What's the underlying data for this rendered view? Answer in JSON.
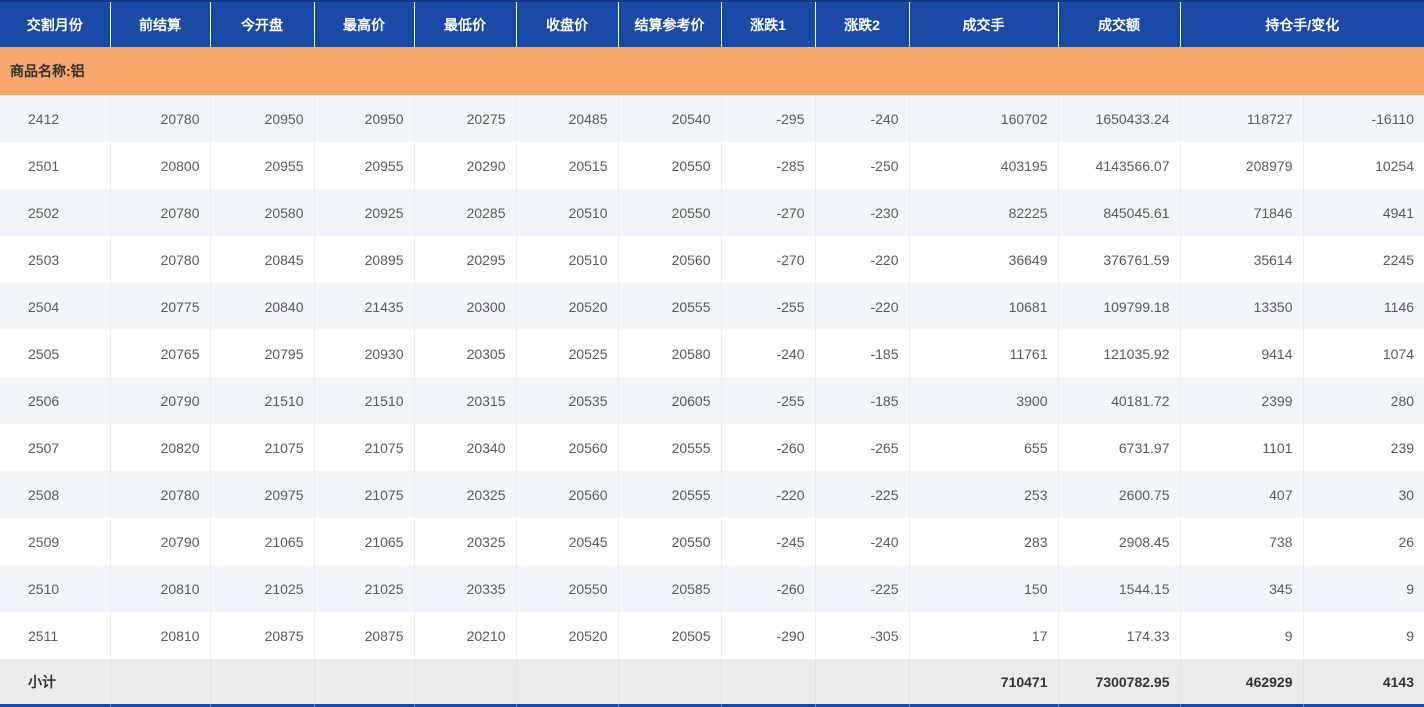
{
  "table": {
    "headers": [
      "交割月份",
      "前结算",
      "今开盘",
      "最高价",
      "最低价",
      "收盘价",
      "结算参考价",
      "涨跌1",
      "涨跌2",
      "成交手",
      "成交额",
      "持仓手/变化"
    ],
    "section_label": "商品名称:铝",
    "field_order": [
      "month",
      "prev_settlement",
      "open",
      "high",
      "low",
      "close",
      "settlement_ref",
      "change1",
      "change2",
      "volume",
      "turnover",
      "open_interest",
      "oi_change"
    ],
    "rows": [
      {
        "month": "2412",
        "prev_settlement": "20780",
        "open": "20950",
        "high": "20950",
        "low": "20275",
        "close": "20485",
        "settlement_ref": "20540",
        "change1": "-295",
        "change2": "-240",
        "volume": "160702",
        "turnover": "1650433.24",
        "open_interest": "118727",
        "oi_change": "-16110"
      },
      {
        "month": "2501",
        "prev_settlement": "20800",
        "open": "20955",
        "high": "20955",
        "low": "20290",
        "close": "20515",
        "settlement_ref": "20550",
        "change1": "-285",
        "change2": "-250",
        "volume": "403195",
        "turnover": "4143566.07",
        "open_interest": "208979",
        "oi_change": "10254"
      },
      {
        "month": "2502",
        "prev_settlement": "20780",
        "open": "20580",
        "high": "20925",
        "low": "20285",
        "close": "20510",
        "settlement_ref": "20550",
        "change1": "-270",
        "change2": "-230",
        "volume": "82225",
        "turnover": "845045.61",
        "open_interest": "71846",
        "oi_change": "4941"
      },
      {
        "month": "2503",
        "prev_settlement": "20780",
        "open": "20845",
        "high": "20895",
        "low": "20295",
        "close": "20510",
        "settlement_ref": "20560",
        "change1": "-270",
        "change2": "-220",
        "volume": "36649",
        "turnover": "376761.59",
        "open_interest": "35614",
        "oi_change": "2245"
      },
      {
        "month": "2504",
        "prev_settlement": "20775",
        "open": "20840",
        "high": "21435",
        "low": "20300",
        "close": "20520",
        "settlement_ref": "20555",
        "change1": "-255",
        "change2": "-220",
        "volume": "10681",
        "turnover": "109799.18",
        "open_interest": "13350",
        "oi_change": "1146"
      },
      {
        "month": "2505",
        "prev_settlement": "20765",
        "open": "20795",
        "high": "20930",
        "low": "20305",
        "close": "20525",
        "settlement_ref": "20580",
        "change1": "-240",
        "change2": "-185",
        "volume": "11761",
        "turnover": "121035.92",
        "open_interest": "9414",
        "oi_change": "1074"
      },
      {
        "month": "2506",
        "prev_settlement": "20790",
        "open": "21510",
        "high": "21510",
        "low": "20315",
        "close": "20535",
        "settlement_ref": "20605",
        "change1": "-255",
        "change2": "-185",
        "volume": "3900",
        "turnover": "40181.72",
        "open_interest": "2399",
        "oi_change": "280"
      },
      {
        "month": "2507",
        "prev_settlement": "20820",
        "open": "21075",
        "high": "21075",
        "low": "20340",
        "close": "20560",
        "settlement_ref": "20555",
        "change1": "-260",
        "change2": "-265",
        "volume": "655",
        "turnover": "6731.97",
        "open_interest": "1101",
        "oi_change": "239"
      },
      {
        "month": "2508",
        "prev_settlement": "20780",
        "open": "20975",
        "high": "21075",
        "low": "20325",
        "close": "20560",
        "settlement_ref": "20555",
        "change1": "-220",
        "change2": "-225",
        "volume": "253",
        "turnover": "2600.75",
        "open_interest": "407",
        "oi_change": "30"
      },
      {
        "month": "2509",
        "prev_settlement": "20790",
        "open": "21065",
        "high": "21065",
        "low": "20325",
        "close": "20545",
        "settlement_ref": "20550",
        "change1": "-245",
        "change2": "-240",
        "volume": "283",
        "turnover": "2908.45",
        "open_interest": "738",
        "oi_change": "26"
      },
      {
        "month": "2510",
        "prev_settlement": "20810",
        "open": "21025",
        "high": "21025",
        "low": "20335",
        "close": "20550",
        "settlement_ref": "20585",
        "change1": "-260",
        "change2": "-225",
        "volume": "150",
        "turnover": "1544.15",
        "open_interest": "345",
        "oi_change": "9"
      },
      {
        "month": "2511",
        "prev_settlement": "20810",
        "open": "20875",
        "high": "20875",
        "low": "20210",
        "close": "20520",
        "settlement_ref": "20505",
        "change1": "-290",
        "change2": "-305",
        "volume": "17",
        "turnover": "174.33",
        "open_interest": "9",
        "oi_change": "9"
      }
    ],
    "subtotal": {
      "label": "小计",
      "volume": "710471",
      "turnover": "7300782.95",
      "open_interest": "462929",
      "oi_change": "4143"
    }
  },
  "colors": {
    "header_bg": "#1a4aa5",
    "section_bg": "#f8a76e",
    "row_alt_bg": "#f2f5fa",
    "row_bg": "#ffffff",
    "subtotal_bg": "#ebebeb",
    "data_text": "#555b63"
  }
}
